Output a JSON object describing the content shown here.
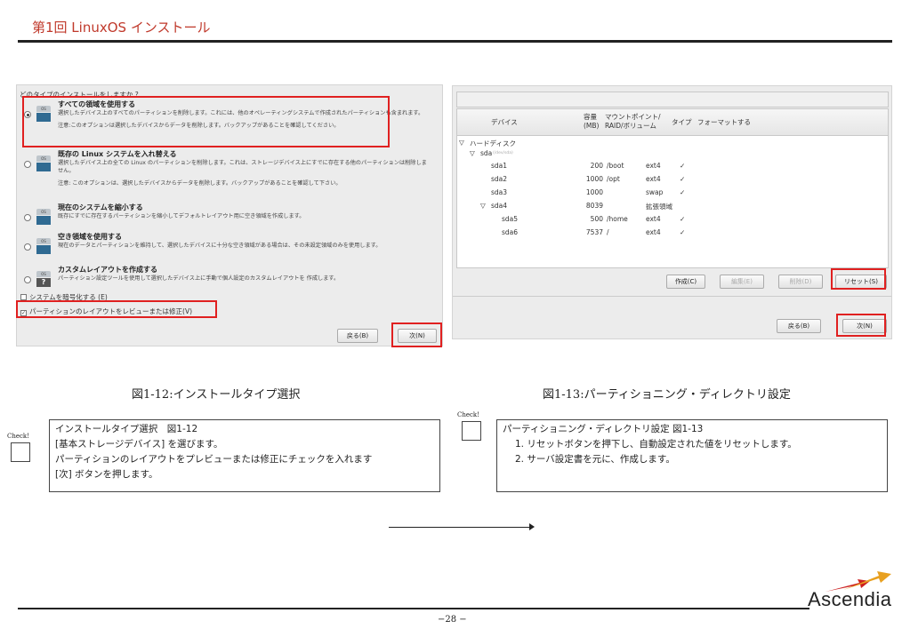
{
  "header": {
    "title": "第1回 LinuxOS インストール"
  },
  "install_type": {
    "question": "どのタイプのインストールをしますか ?",
    "icon_badge": "OS",
    "options": [
      {
        "title": "すべての領域を使用する",
        "desc": "選択したデバイス上のすべてのパーティションを削除します。これには、他のオペレーティングシステムで作成されたパーティションも含まれます。",
        "note": "注意:このオプションは選択したデバイスからデータを削除します。バックアップがあることを確認してください。",
        "selected": true
      },
      {
        "title": "既存の Linux システムを入れ替える",
        "desc": "選択したデバイス上の全ての Linux のパーティションを削除します。これは、ストレージデバイス上にすでに存在する他のパーティションは削除しません。",
        "note": "注意: このオプションは、選択したデバイスからデータを削除します。バックアップがあることを確認して下さい。",
        "selected": false
      },
      {
        "title": "現在のシステムを縮小する",
        "desc": "既存にすでに存在するパーティションを縮小してデフォルトレイアウト用に空き領域を作成します。",
        "note": "",
        "selected": false
      },
      {
        "title": "空き領域を使用する",
        "desc": "現在のデータとパーティションを維持して、選択したデバイスに十分な空き領域がある場合は、その未設定領域のみを使用します。",
        "note": "",
        "selected": false
      },
      {
        "title": "カスタムレイアウトを作成する",
        "desc": "パーティション設定ツールを使用して選択したデバイス上に手動で個人設定のカスタムレイアウトを 作成します。",
        "note": "",
        "selected": false,
        "custom_icon": "?"
      }
    ],
    "encrypt_label": "システムを暗号化する (E)",
    "review_label": "パーティションのレイアウトをレビューまたは修正(V)",
    "back_button": "戻る(B)",
    "next_button": "次(N)"
  },
  "partition": {
    "columns": {
      "device": "デバイス",
      "size": "容量\n(MB)",
      "mount": "マウントポイント/\nRAID/ボリューム",
      "type": "タイプ",
      "format": "フォーマットする"
    },
    "group": "ハードディスク",
    "disk": "sda",
    "disk_path": "(/dev/sda)",
    "rows": [
      {
        "device": "sda1",
        "size": "200",
        "mount": "/boot",
        "type": "ext4",
        "format": "✓"
      },
      {
        "device": "sda2",
        "size": "1000",
        "mount": "/opt",
        "type": "ext4",
        "format": "✓"
      },
      {
        "device": "sda3",
        "size": "1000",
        "mount": "",
        "type": "swap",
        "format": "✓"
      },
      {
        "device": "sda4",
        "size": "8039",
        "mount": "",
        "type": "拡張領域",
        "format": ""
      },
      {
        "device": "sda5",
        "size": "500",
        "mount": "/home",
        "type": "ext4",
        "format": "✓"
      },
      {
        "device": "sda6",
        "size": "7537",
        "mount": "/",
        "type": "ext4",
        "format": "✓"
      }
    ],
    "create_button": "作成(C)",
    "edit_button": "編集(E)",
    "delete_button": "削除(D)",
    "reset_button": "リセット(S)",
    "back_button": "戻る(B)",
    "next_button": "次(N)"
  },
  "captions": {
    "left": "図1-12:インストールタイプ選択",
    "right": "図1-13:パーティショニング・ディレクトリ設定"
  },
  "notes": {
    "check_label": "Check!",
    "left_lines": [
      "インストールタイプ選択　図1-12",
      "[基本ストレージデバイス] を選びます。",
      "パーティションのレイアウトをプレビューまたは修正にチェックを入れます",
      "[次] ボタンを押します。"
    ],
    "right_lines": [
      "パーティショニング・ディレクトリ設定 図1-13",
      "1. リセットボタンを押下し、自動設定された値をリセットします。",
      "2. サーバ設定書を元に、作成します。"
    ]
  },
  "footer": {
    "page": "−28 −",
    "logo": "Ascendia"
  },
  "colors": {
    "title": "#c0392b",
    "highlight": "#e02020",
    "logo_arrow_orange": "#e8a020",
    "logo_arrow_red": "#cc2020"
  }
}
